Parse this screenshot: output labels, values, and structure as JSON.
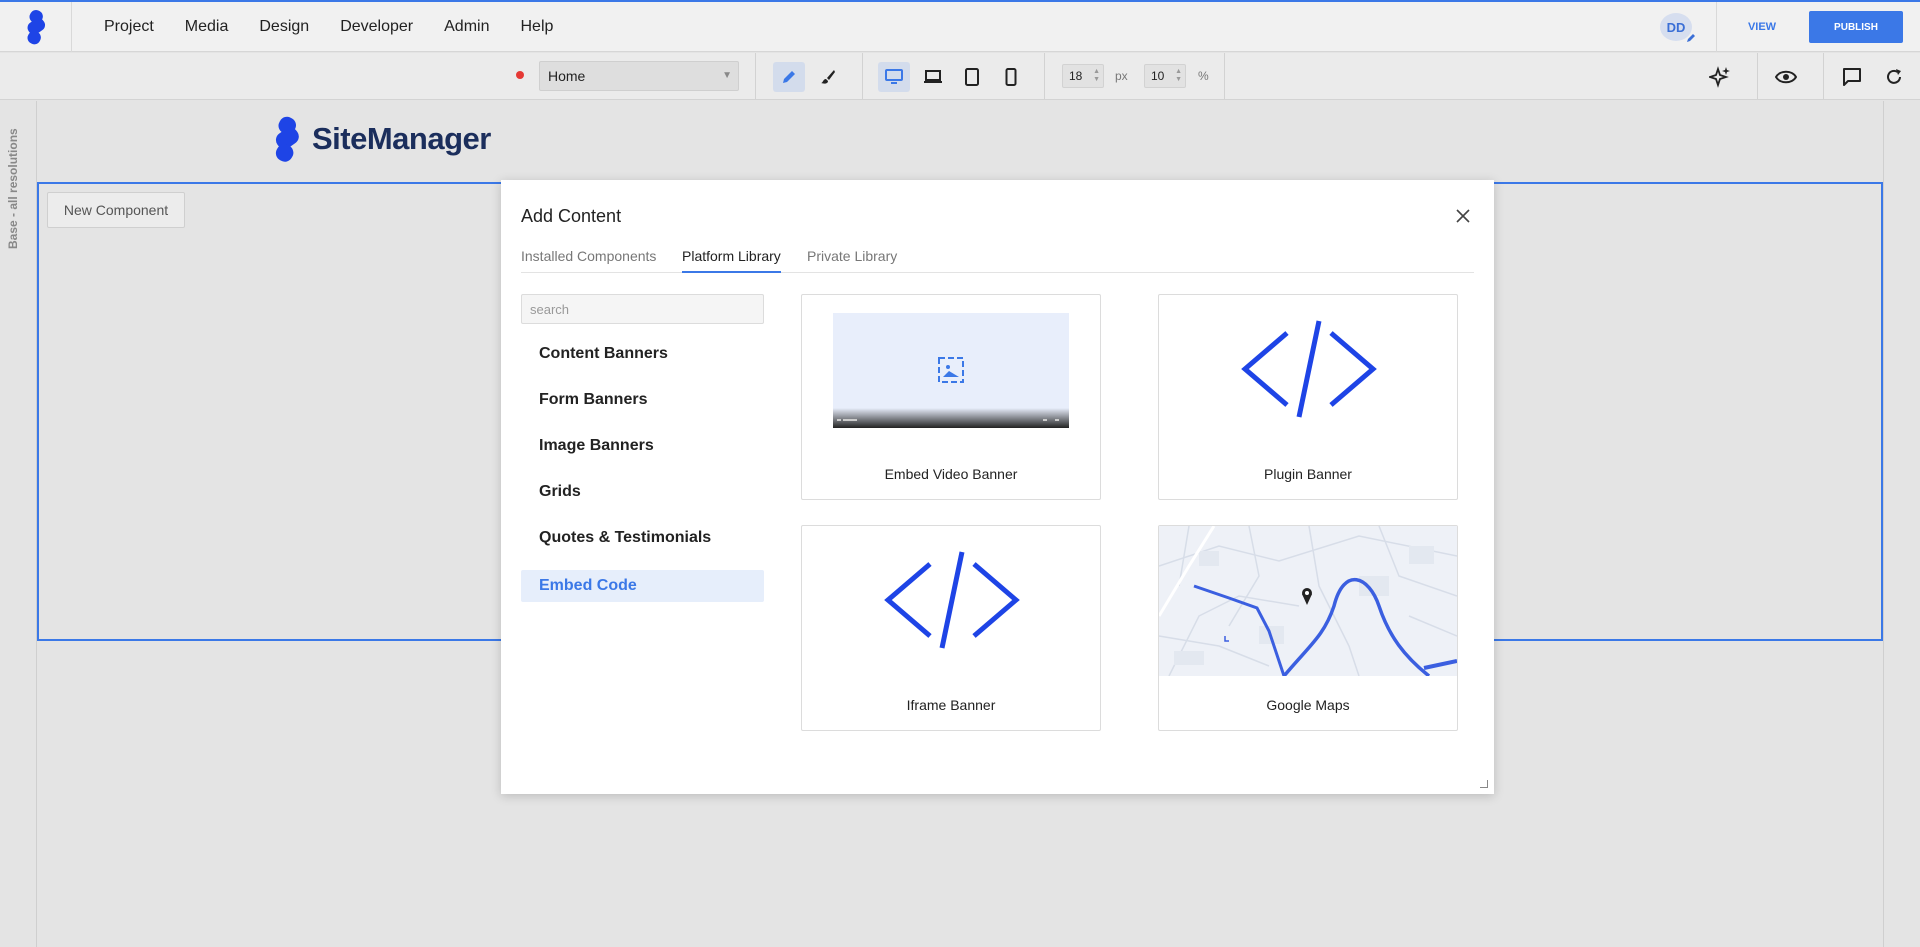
{
  "nav": {
    "items": [
      "Project",
      "Media",
      "Design",
      "Developer",
      "Admin",
      "Help"
    ],
    "avatar_initials": "DD",
    "view_label": "VIEW",
    "publish_label": "PUBLISH"
  },
  "toolbar": {
    "page_select": "Home",
    "font_size_value": "18",
    "font_size_unit": "px",
    "percent_value": "10",
    "percent_unit": "%"
  },
  "canvas": {
    "side_label": "Base - all resolutions",
    "site_logo_text": "SiteManager",
    "new_component_label": "New Component"
  },
  "modal": {
    "title": "Add Content",
    "tabs": [
      {
        "label": "Installed Components",
        "active": false
      },
      {
        "label": "Platform Library",
        "active": true
      },
      {
        "label": "Private Library",
        "active": false
      }
    ],
    "search_placeholder": "search",
    "categories": [
      {
        "label": "Content Banners",
        "active": false
      },
      {
        "label": "Form Banners",
        "active": false
      },
      {
        "label": "Image Banners",
        "active": false
      },
      {
        "label": "Grids",
        "active": false
      },
      {
        "label": "Quotes & Testimonials",
        "active": false
      },
      {
        "label": "Embed Code",
        "active": true
      }
    ],
    "cards": [
      {
        "label": "Embed Video Banner",
        "icon": "video-thumbnail-icon"
      },
      {
        "label": "Plugin Banner",
        "icon": "code-icon"
      },
      {
        "label": "Iframe Banner",
        "icon": "code-icon"
      },
      {
        "label": "Google Maps",
        "icon": "map-thumbnail-icon"
      }
    ]
  },
  "colors": {
    "accent": "#3b78e7",
    "code_icon": "#1e44e6",
    "brand_dark": "#1b2e5c"
  }
}
